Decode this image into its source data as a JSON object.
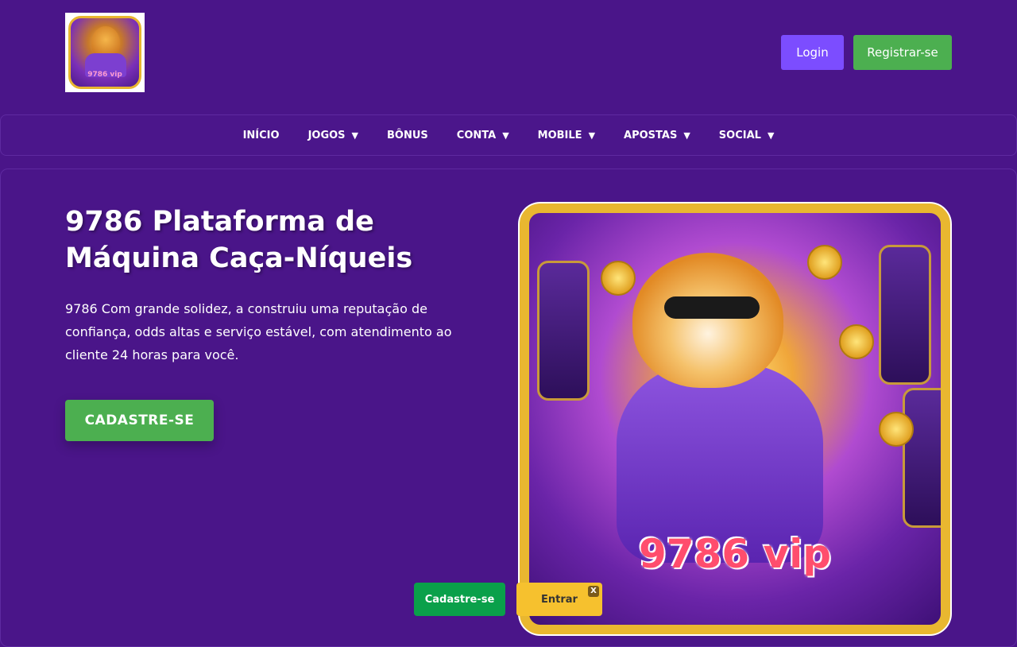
{
  "header": {
    "logo_text": "9786 vip",
    "login_label": "Login",
    "register_label": "Registrar-se"
  },
  "nav": {
    "items": [
      {
        "label": "INÍCIO",
        "dropdown": false
      },
      {
        "label": "JOGOS",
        "dropdown": true
      },
      {
        "label": "BÔNUS",
        "dropdown": false
      },
      {
        "label": "CONTA",
        "dropdown": true
      },
      {
        "label": "MOBILE",
        "dropdown": true
      },
      {
        "label": "APOSTAS",
        "dropdown": true
      },
      {
        "label": "SOCIAL",
        "dropdown": true
      }
    ],
    "caret": "▼"
  },
  "hero": {
    "title": "9786 Plataforma de Máquina Caça-Níqueis",
    "description": "9786 Com grande solidez, a construiu uma reputação de confiança, odds altas e serviço estável, com atendimento ao cliente 24 horas para você.",
    "cta_label": "CADASTRE-SE",
    "image_text": "9786 vip"
  },
  "floating_bar": {
    "register_label": "Cadastre-se",
    "enter_label": "Entrar",
    "close_label": "X"
  },
  "colors": {
    "background": "#4a1589",
    "login": "#7c4dff",
    "register": "#4caf50",
    "enter": "#f6c12e"
  }
}
